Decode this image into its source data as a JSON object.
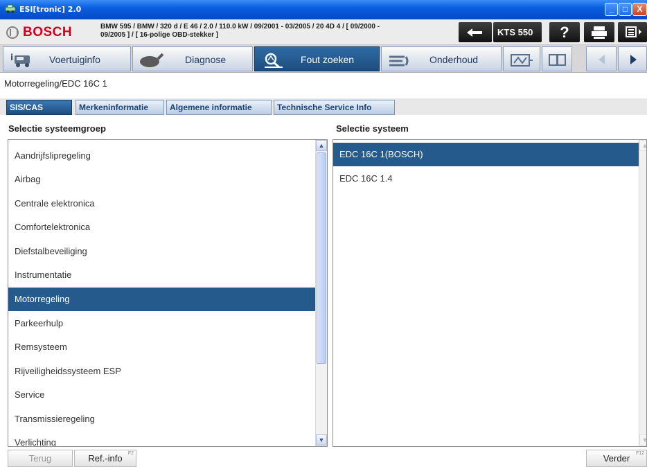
{
  "window": {
    "title": "ESI[tronic] 2.0",
    "buttons": {
      "minimize": "_",
      "maximize": "□",
      "close": "X"
    }
  },
  "header": {
    "brand": "BOSCH",
    "vehicle_line1": "BMW 595 / BMW / 320 d / E 46 / 2.0 / 110.0 kW / 09/2001 - 03/2005 / 20 4D 4 / [ 09/2000 -",
    "vehicle_line2": "09/2005 ] / [ 16-polige OBD-stekker ]",
    "device": "KTS 550",
    "help": "?"
  },
  "nav": {
    "tabs": [
      {
        "label": "Voertuiginfo",
        "icon": "vehicle-info-icon"
      },
      {
        "label": "Diagnose",
        "icon": "diagnosis-plug-icon"
      },
      {
        "label": "Fout zoeken",
        "icon": "troubleshooting-icon",
        "active": true
      },
      {
        "label": "Onderhoud",
        "icon": "maintenance-icon"
      }
    ]
  },
  "breadcrumb": "Motorregeling/EDC 16C 1",
  "info_tabs": [
    {
      "label": "SIS/CAS",
      "active": true
    },
    {
      "label": "Merkeninformatie"
    },
    {
      "label": "Algemene informatie"
    },
    {
      "label": "Technische Service Info"
    }
  ],
  "left_panel": {
    "heading": "Selectie systeemgroep",
    "items": [
      "Aandrijfslipregeling",
      "Airbag",
      "Centrale elektronica",
      "Comfortelektronica",
      "Diefstalbeveiliging",
      "Instrumentatie",
      "Motorregeling",
      "Parkeerhulp",
      "Remsysteem",
      "Rijveiligheidssysteem ESP",
      "Service",
      "Transmissieregeling",
      "Verlichting"
    ],
    "selected": "Motorregeling"
  },
  "right_panel": {
    "heading": "Selectie systeem",
    "items": [
      "EDC 16C 1(BOSCH)",
      "EDC 16C 1.4"
    ],
    "selected": "EDC 16C 1(BOSCH)"
  },
  "footer": {
    "back": "Terug",
    "refinfo": "Ref.-info",
    "refinfo_key": "F2",
    "next": "Verder",
    "next_key": "F12"
  },
  "colors": {
    "selection": "#245b8c",
    "brand_red": "#d2001e",
    "titlebar": "#0a5fe0"
  }
}
